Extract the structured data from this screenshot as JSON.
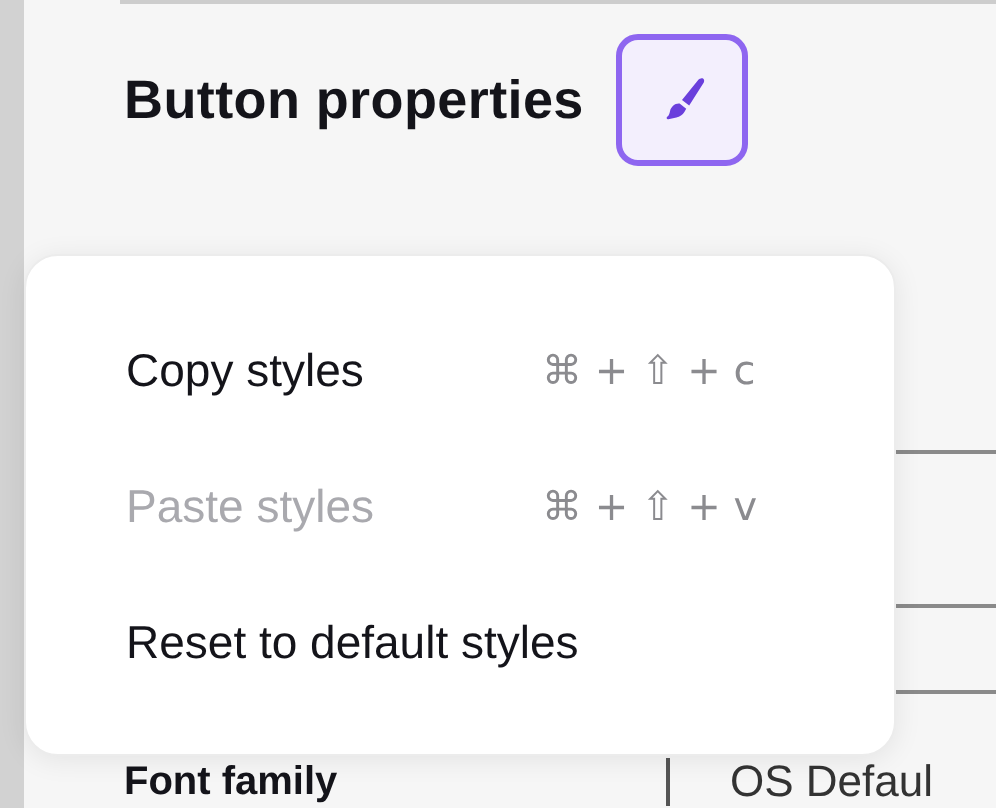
{
  "panel": {
    "title": "Button properties",
    "style_button": {
      "active": true
    }
  },
  "menu": {
    "items": [
      {
        "label": "Copy styles",
        "shortcut": "⌘ + ⇧ + c",
        "disabled": false
      },
      {
        "label": "Paste styles",
        "shortcut": "⌘ + ⇧ + v",
        "disabled": true
      },
      {
        "label": "Reset to default styles",
        "disabled": false
      }
    ]
  },
  "properties": [
    {
      "label": "Font family",
      "value": "OS Defaul"
    }
  ]
}
